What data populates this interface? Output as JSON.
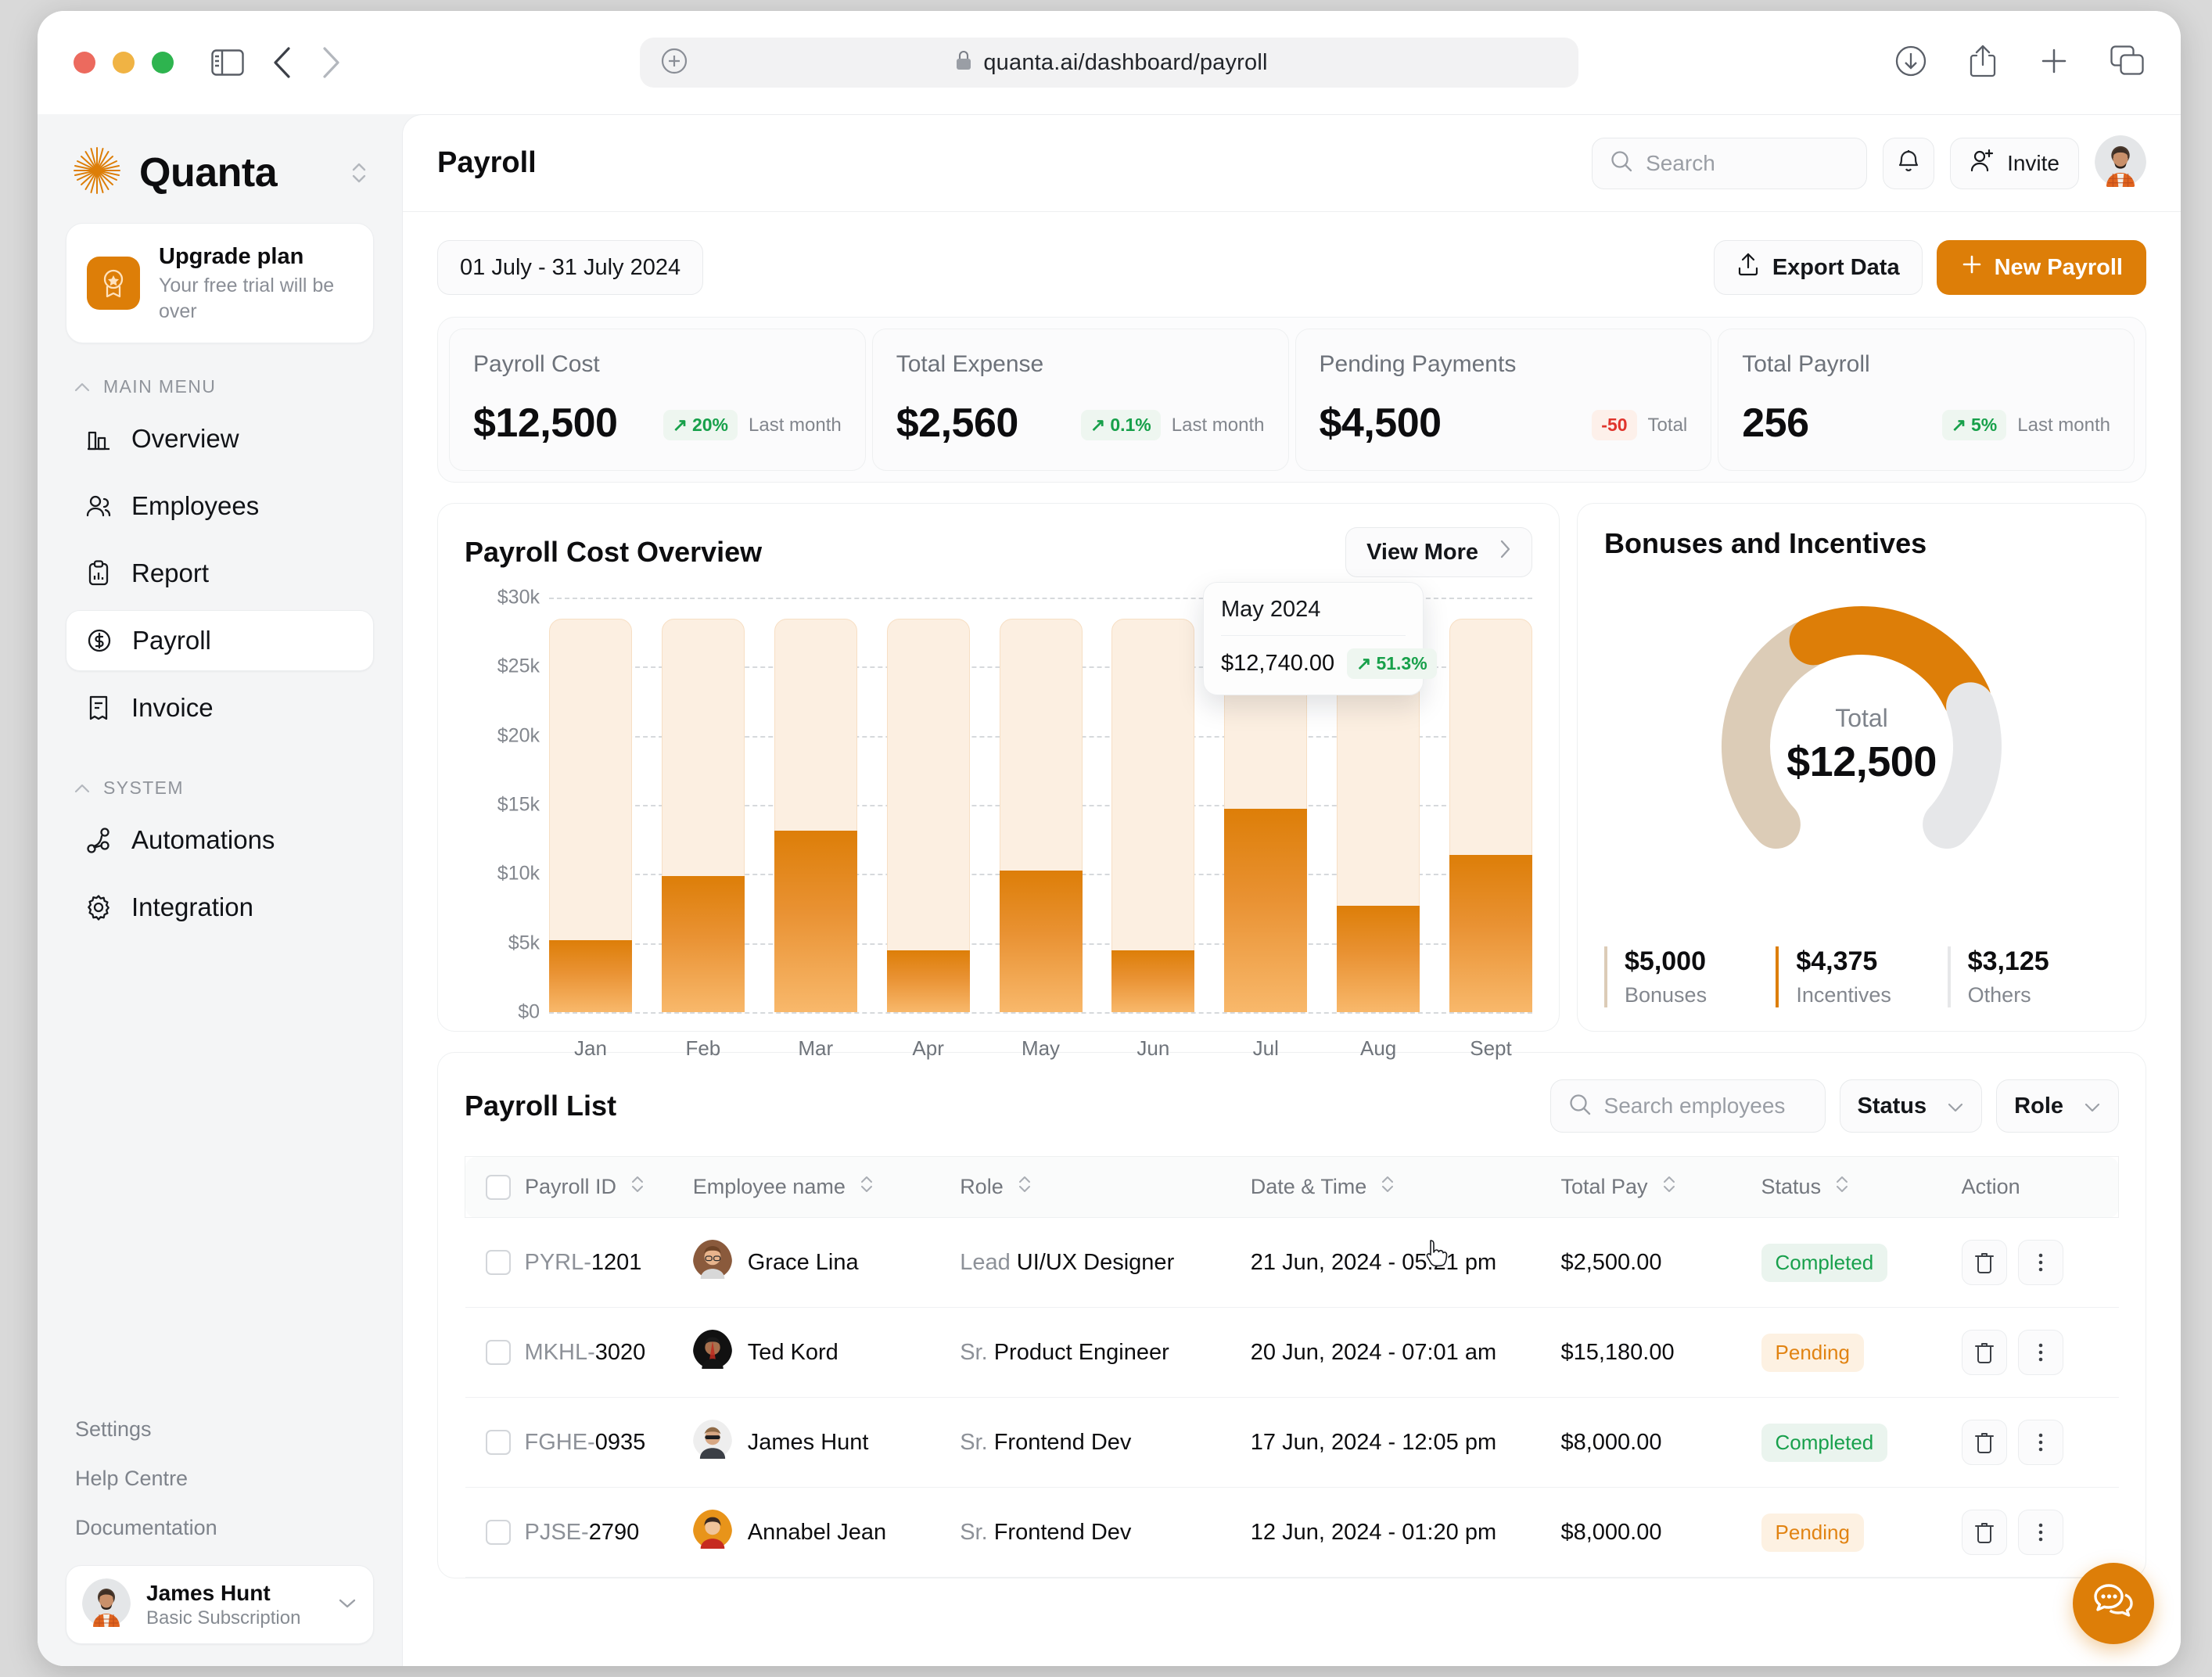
{
  "browser": {
    "url": "quanta.ai/dashboard/payroll",
    "icons": [
      "sidebar-toggle-icon",
      "back-icon",
      "forward-icon",
      "new-tab-icon",
      "downloads-icon",
      "share-icon",
      "add-tab-icon",
      "tabs-overview-icon"
    ]
  },
  "sidebar": {
    "brand": "Quanta",
    "upgrade": {
      "title": "Upgrade plan",
      "subtitle": "Your free trial will be over"
    },
    "sections": [
      {
        "label": "MAIN MENU",
        "items": [
          {
            "label": "Overview",
            "icon": "bar-chart-icon",
            "active": false
          },
          {
            "label": "Employees",
            "icon": "users-icon",
            "active": false
          },
          {
            "label": "Report",
            "icon": "clipboard-icon",
            "active": false
          },
          {
            "label": "Payroll",
            "icon": "dollar-circle-icon",
            "active": true
          },
          {
            "label": "Invoice",
            "icon": "invoice-icon",
            "active": false
          }
        ]
      },
      {
        "label": "SYSTEM",
        "items": [
          {
            "label": "Automations",
            "icon": "automation-icon",
            "active": false
          },
          {
            "label": "Integration",
            "icon": "gear-icon",
            "active": false
          }
        ]
      }
    ],
    "bottom_links": [
      "Settings",
      "Help Centre",
      "Documentation"
    ],
    "user": {
      "name": "James Hunt",
      "plan": "Basic Subscription"
    }
  },
  "header": {
    "title": "Payroll",
    "search_placeholder": "Search",
    "invite_label": "Invite"
  },
  "actions": {
    "date_range": "01 July - 31 July 2024",
    "export_label": "Export Data",
    "new_payroll_label": "New Payroll"
  },
  "stats": [
    {
      "label": "Payroll Cost",
      "value": "$12,500",
      "chip": "20%",
      "chip_dir": "up",
      "meta": "Last month"
    },
    {
      "label": "Total Expense",
      "value": "$2,560",
      "chip": "0.1%",
      "chip_dir": "up",
      "meta": "Last month"
    },
    {
      "label": "Pending Payments",
      "value": "$4,500",
      "chip": "-50",
      "chip_dir": "down",
      "meta": "Total"
    },
    {
      "label": "Total Payroll",
      "value": "256",
      "chip": "5%",
      "chip_dir": "up",
      "meta": "Last month"
    }
  ],
  "chart_card": {
    "title": "Payroll Cost Overview",
    "view_more_label": "View More",
    "tooltip": {
      "title": "May 2024",
      "value": "$12,740.00",
      "chip": "51.3%",
      "chip_dir": "up"
    }
  },
  "chart_data": {
    "type": "bar",
    "title": "Payroll Cost Overview",
    "categories": [
      "Jan",
      "Feb",
      "Mar",
      "Apr",
      "May",
      "Jun",
      "Jul",
      "Aug",
      "Sept"
    ],
    "values": [
      5200,
      9850,
      13150,
      4500,
      10250,
      4500,
      14700,
      7700,
      11400
    ],
    "background_values": [
      28500,
      28500,
      28500,
      28500,
      28500,
      28500,
      28500,
      28500,
      28500
    ],
    "ytick_labels": [
      "$30k",
      "$25k",
      "$20k",
      "$15k",
      "$10k",
      "$5k",
      "$0"
    ],
    "ytick_values": [
      30000,
      25000,
      20000,
      15000,
      10000,
      5000,
      0
    ],
    "ylim": [
      0,
      30000
    ],
    "xlabel": "",
    "ylabel": "",
    "grid": true,
    "legend": "none",
    "series_name": "Payroll Cost",
    "highlight_category": "May",
    "highlight_value": "$12,740.00",
    "highlight_change": "51.3%"
  },
  "bonuses": {
    "title": "Bonuses and Incentives",
    "total_label": "Total",
    "total_value": "$12,500",
    "segments": [
      {
        "label": "Bonuses",
        "value": "$5,000",
        "amount": 5000,
        "color": "#dcccb7"
      },
      {
        "label": "Incentives",
        "value": "$4,375",
        "amount": 4375,
        "color": "#dd7e08"
      },
      {
        "label": "Others",
        "value": "$3,125",
        "amount": 3125,
        "color": "#e6e7e9"
      }
    ]
  },
  "payroll_list": {
    "title": "Payroll List",
    "search_placeholder": "Search employees",
    "status_filter": "Status",
    "role_filter": "Role",
    "columns": [
      "Payroll ID",
      "Employee name",
      "Role",
      "Date & Time",
      "Total Pay",
      "Status",
      "Action"
    ],
    "rows": [
      {
        "id_prefix": "PYRL-",
        "id_num": "1201",
        "name": "Grace Lina",
        "role_pre": "Lead ",
        "role": "UI/UX Designer",
        "datetime": "21 Jun, 2024 - 05:21 pm",
        "pay": "$2,500.00",
        "status": "Completed"
      },
      {
        "id_prefix": "MKHL-",
        "id_num": "3020",
        "name": "Ted Kord",
        "role_pre": "Sr. ",
        "role": "Product Engineer",
        "datetime": "20 Jun, 2024 - 07:01 am",
        "pay": "$15,180.00",
        "status": "Pending"
      },
      {
        "id_prefix": "FGHE-",
        "id_num": "0935",
        "name": "James Hunt",
        "role_pre": "Sr. ",
        "role": "Frontend Dev",
        "datetime": "17 Jun, 2024 - 12:05 pm",
        "pay": "$8,000.00",
        "status": "Completed"
      },
      {
        "id_prefix": "PJSE-",
        "id_num": "2790",
        "name": "Annabel Jean",
        "role_pre": "Sr. ",
        "role": "Frontend Dev",
        "datetime": "12 Jun, 2024 - 01:20 pm",
        "pay": "$8,000.00",
        "status": "Pending"
      }
    ]
  },
  "colors": {
    "accent": "#dd7e08",
    "accent_light": "#fcefe1",
    "success": "#17a04a",
    "danger": "#e0342c",
    "pending": "#e18312"
  }
}
